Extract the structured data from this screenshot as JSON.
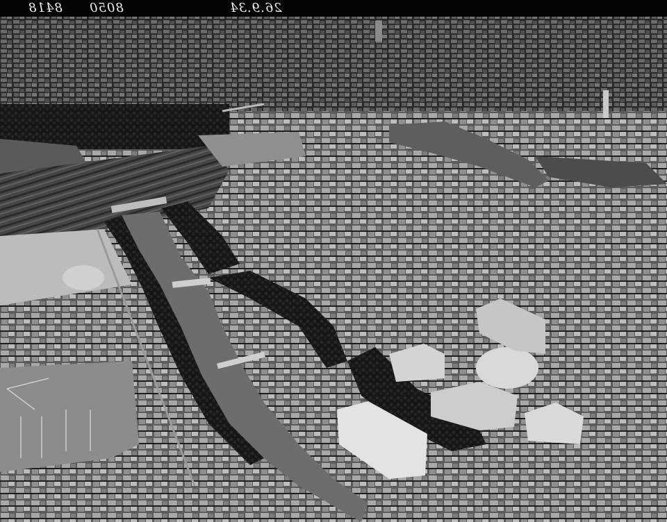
{
  "photo": {
    "subject": "aerial-city-river",
    "palette": {
      "background": "#3a3a3a",
      "rooftops_light": "#d6d6d6",
      "rooftops_mid": "#9a9a9a",
      "shadow": "#1a1a1a",
      "river": "#6d6d6d",
      "trees": "#141414",
      "rail_yard": "#474747",
      "field": "#8c8c8c"
    }
  },
  "negative_edge": {
    "archive_code": "8418",
    "plate_number": "8050",
    "date": "26.9.34"
  }
}
